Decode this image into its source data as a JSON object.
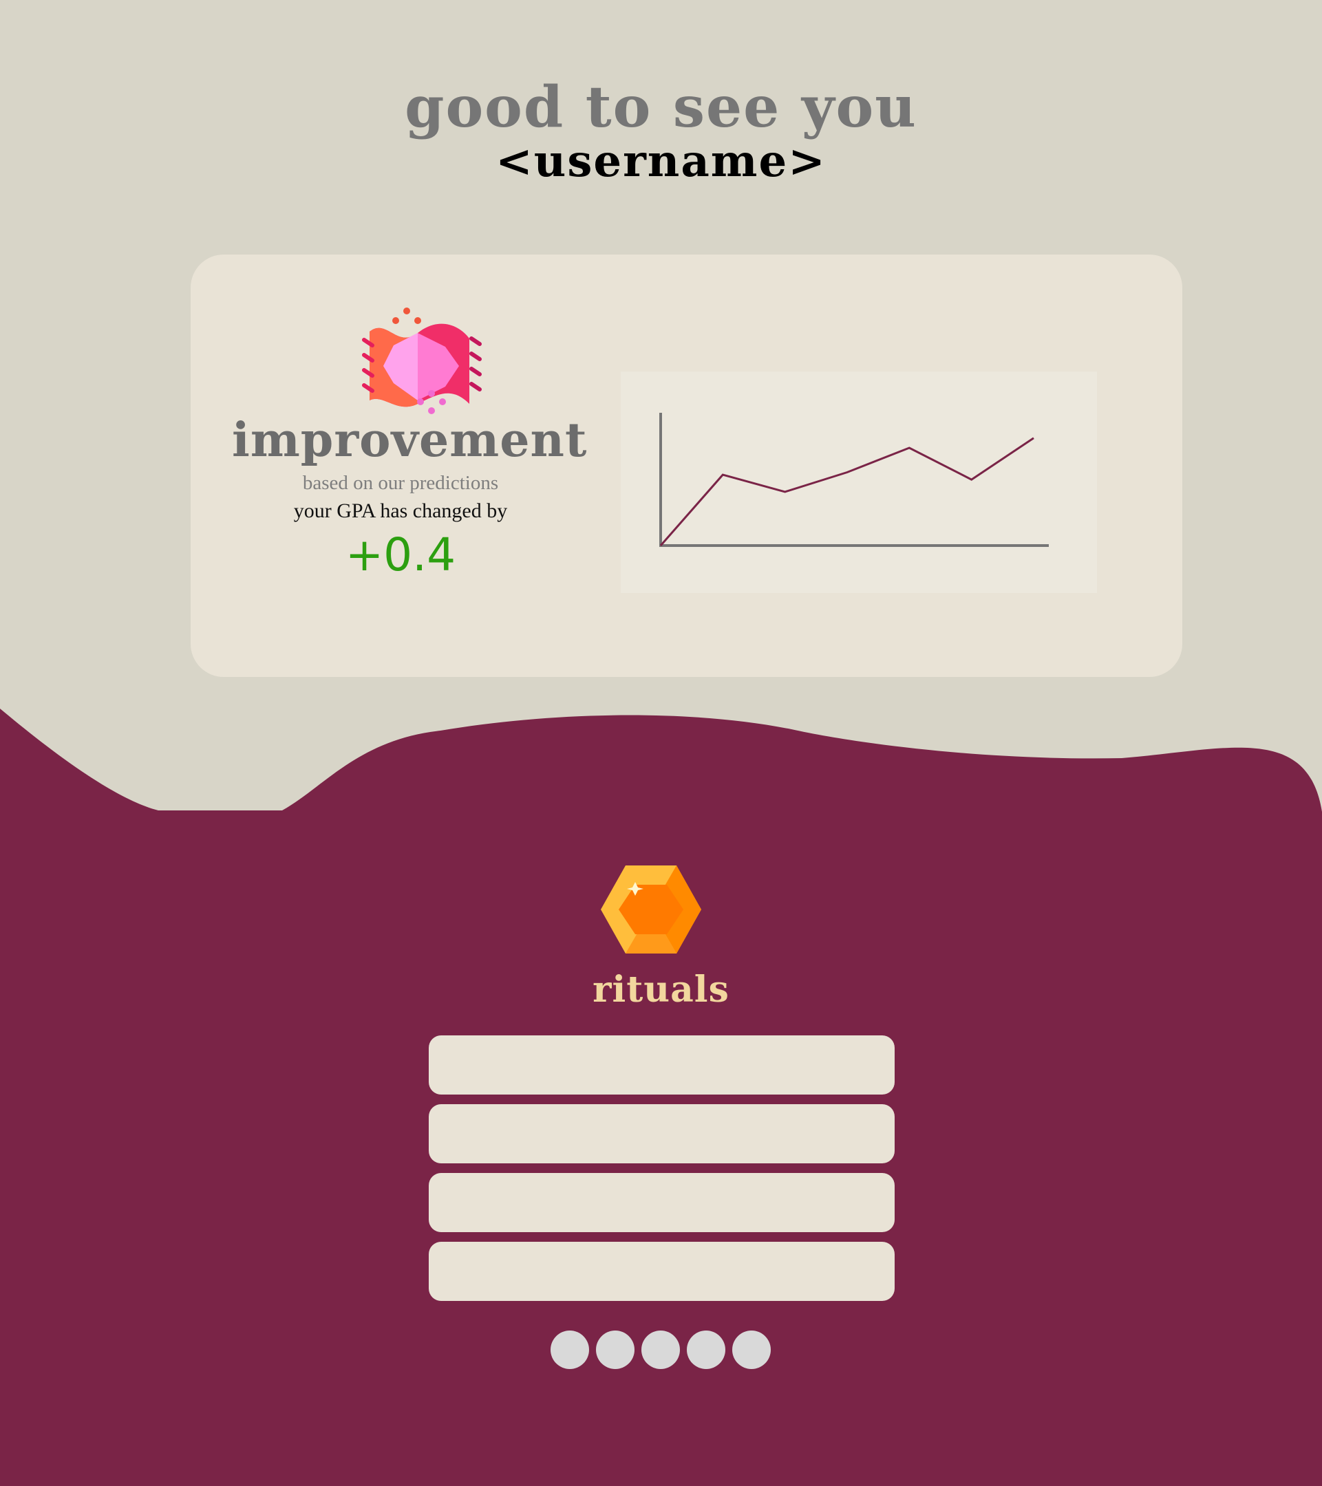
{
  "header": {
    "greeting": "good to see you",
    "username": "<username>"
  },
  "improvement": {
    "icon": "improvement-scroll-icon",
    "title": "improvement",
    "subtitle": "based on our predictions",
    "description": "your GPA has changed by",
    "value": "+0.4",
    "value_color": "#2c9f10"
  },
  "chart_data": {
    "type": "line",
    "x": [
      0,
      1,
      2,
      3,
      4,
      5,
      6
    ],
    "series": [
      {
        "values": [
          0,
          2.9,
          2.2,
          3.0,
          4.0,
          2.7,
          4.4
        ]
      }
    ],
    "xlabel": "",
    "ylabel": "",
    "ylim": [
      0,
      6
    ],
    "grid": false,
    "line_color": "#7a2447"
  },
  "rituals": {
    "icon": "gem-icon",
    "title": "rituals",
    "items": [
      "",
      "",
      "",
      ""
    ],
    "pagination_count": 5
  },
  "colors": {
    "background_top": "#d8d5c8",
    "background_bottom": "#7a2447",
    "card": "#e9e3d6",
    "rituals_title": "#f2d79e"
  }
}
